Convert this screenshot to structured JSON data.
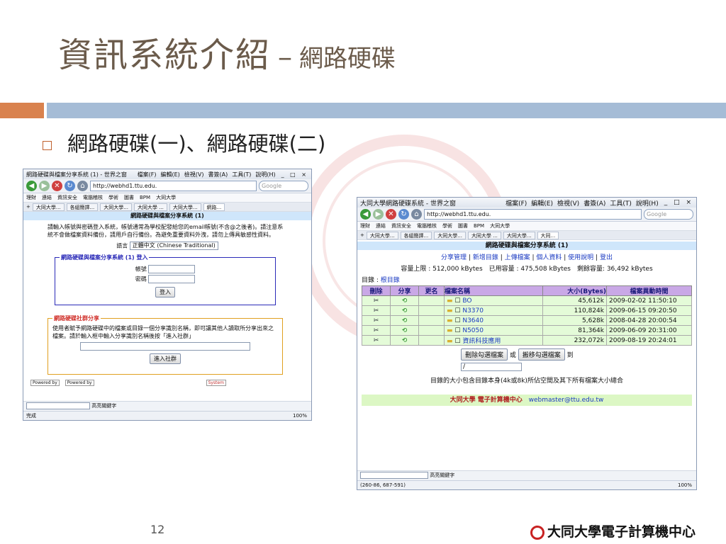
{
  "slide": {
    "title_main": "資訊系統介紹",
    "title_dash": "–",
    "title_sub": "網路硬碟",
    "bullet": "網路硬碟(一)、網路硬碟(二)",
    "page_number": "12",
    "logo_text": "大同大學電子計算機中心"
  },
  "browser1": {
    "window_title": "網路硬碟與檔案分享系統 (1) - 世界之窗",
    "menus": [
      "檔案(F)",
      "編輯(E)",
      "檢視(V)",
      "書簽(A)",
      "工具(T)",
      "說明(H)"
    ],
    "url": "http://webhd1.ttu.edu.",
    "search_placeholder": "Google",
    "bookmarks": [
      "理財",
      "連結",
      "資訊安全",
      "電腦稽核",
      "學術",
      "圖書",
      "BPM",
      "大同大學"
    ],
    "tabs": [
      "大同大學...",
      "各組簡譯...",
      "大同大學...",
      "大同大學 ...",
      "大同大學...",
      "網路..."
    ],
    "header": "網路硬碟與檔案分享系統 (1)",
    "intro": "請輸入帳號與密碼登入系統，帳號通常為學校配發給您的email帳號(不含@之後者)。請注意系統不會做檔案資料備份，請用戶自行備份。為避免重要資料外洩，請勿上傳具敏感性資料。",
    "lang_label": "語言",
    "lang_value": "正體中文 (Chinese Traditional)",
    "login_legend": "網路硬碟與檔案分享系統 (1) 登入",
    "account_label": "帳號",
    "password_label": "密碼",
    "login_button": "登入",
    "share_legend": "網路硬碟社群分享",
    "share_text": "使用者賦予網路硬碟中的檔案或目錄一個分享識別名稱，即可讓其他人讀取所分享出來之檔案。請於輸入框中輸入分享識別名稱後按「進入社群」",
    "enter_button": "進入社群",
    "powered1": "Powered by",
    "powered2": "Powered by",
    "system": "System",
    "find_label": "高亮關鍵字",
    "status": "完成",
    "zoom": "100%"
  },
  "browser2": {
    "window_title": "大同大學網路硬碟系統 - 世界之窗",
    "menus": [
      "檔案(F)",
      "編輯(E)",
      "檢視(V)",
      "書簽(A)",
      "工具(T)",
      "說明(H)"
    ],
    "url": "http://webhd1.ttu.edu.",
    "search_placeholder": "Google",
    "bookmarks": [
      "理財",
      "連結",
      "資訊安全",
      "電腦稽核",
      "學術",
      "圖書",
      "BPM",
      "大同大學"
    ],
    "tabs": [
      "大同大學...",
      "各組簡譯...",
      "大同大學...",
      "大同大學 ...",
      "大同大學...",
      "大同..."
    ],
    "header": "網路硬碟與檔案分享系統 (1)",
    "nav_links": [
      "分享管理",
      "新增目錄",
      "上傳檔案",
      "個人資料",
      "使用說明",
      "登出"
    ],
    "quota": "容量上限 : 512,000 kBytes　已用容量 : 475,508 kBytes　剩餘容量: 36,492 kBytes",
    "dir_label": "目錄 :",
    "dir_link": "根目錄",
    "columns": [
      "刪除",
      "分享",
      "更名",
      "檔案名稱",
      "大小(Bytes)",
      "檔案異動時間"
    ],
    "rows": [
      {
        "name": "BO",
        "size": "45,612k",
        "time": "2009-02-02 11:50:10"
      },
      {
        "name": "N3370",
        "size": "110,824k",
        "time": "2009-06-15 09:20:50"
      },
      {
        "name": "N3640",
        "size": "5,628k",
        "time": "2008-04-28 20:00:54"
      },
      {
        "name": "N5050",
        "size": "81,364k",
        "time": "2009-06-09 20:31:00"
      },
      {
        "name": "資訊科技應用",
        "size": "232,072k",
        "time": "2009-08-19 20:24:01"
      }
    ],
    "delete_button": "刪除勾選檔案",
    "or_text": "或",
    "move_button": "搬移勾選檔案",
    "to_text": "到",
    "move_target": "/",
    "note": "目錄的大小包含目錄本身(4k或8k)所佔空間及其下所有檔案大小總合",
    "footer_org": "大同大學 電子計算機中心",
    "footer_email": "webmaster@ttu.edu.tw",
    "find_label": "高亮關鍵字",
    "status": "(260-86, 687-591)",
    "zoom": "100%"
  }
}
